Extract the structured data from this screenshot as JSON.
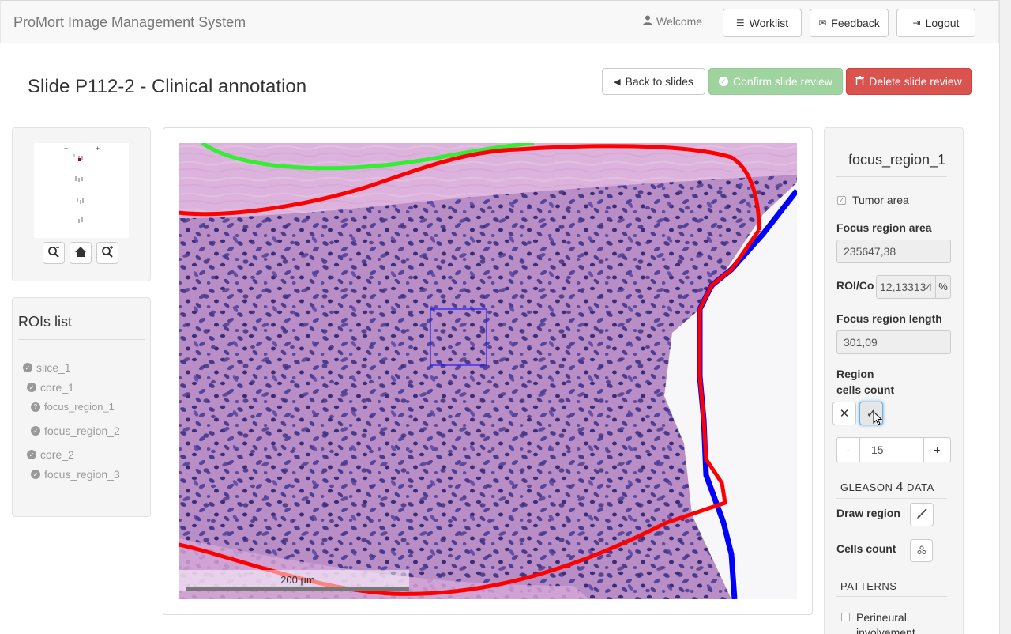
{
  "navbar": {
    "brand": "ProMort Image Management System",
    "welcome": "Welcome",
    "worklist": "Worklist",
    "feedback": "Feedback",
    "logout": "Logout"
  },
  "header": {
    "title": "Slide P112-2 - Clinical annotation",
    "back_label": "Back to slides",
    "confirm_label": "Confirm slide review",
    "delete_label": "Delete slide review"
  },
  "rois": {
    "title": "ROIs list",
    "items": [
      {
        "label": "slice_1"
      },
      {
        "label": "core_1"
      },
      {
        "label": "focus_region_1"
      },
      {
        "label": "focus_region_2"
      },
      {
        "label": "core_2"
      },
      {
        "label": "focus_region_3"
      }
    ]
  },
  "viewer": {
    "scale_label": "200 µm"
  },
  "details": {
    "title": "focus_region_1",
    "tumor_area_label": "Tumor area",
    "tumor_area_checked": true,
    "area_label": "Focus region area",
    "area_value": "235647,38",
    "roi_label": "ROI/Co",
    "roi_value": "12,133134",
    "roi_unit": "%",
    "length_label": "Focus region length",
    "length_value": "301,09",
    "cells_count_label_1": "Region",
    "cells_count_label_2": "cells count",
    "stepper_minus": "-",
    "stepper_value": "15",
    "stepper_plus": "+",
    "gleason_pre": "GLEASON",
    "gleason_num": "4",
    "gleason_post": "DATA",
    "draw_region_label": "Draw region",
    "cells_count_tool_label": "Cells count",
    "patterns_header": "PATTERNS",
    "perineural_label_1": "Perineural",
    "perineural_label_2": "involvement"
  },
  "colors": {
    "success": "#9fd39f",
    "danger": "#d9534f",
    "roi_red": "#ff0000",
    "roi_blue": "#0000ff",
    "roi_green": "#33ee33"
  }
}
